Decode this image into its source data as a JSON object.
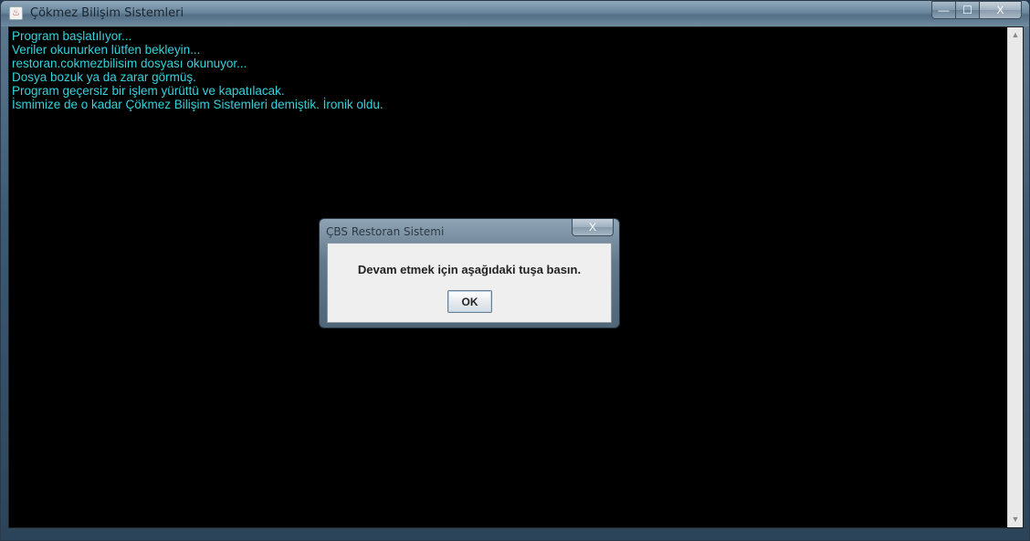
{
  "window": {
    "title": "Çökmez Bilişim Sistemleri",
    "minimize_glyph": "—",
    "maximize_glyph": "☐",
    "close_glyph": "X",
    "app_icon": "java-icon"
  },
  "console": {
    "lines": [
      "Program başlatılıyor...",
      "Veriler okunurken lütfen bekleyin...",
      "restoran.cokmezbilisim dosyası okunuyor...",
      "Dosya bozuk ya da zarar görmüş.",
      "Program geçersiz bir işlem yürüttü ve kapatılacak.",
      "İsmimize de o kadar Çökmez Bilişim Sistemleri demiştik. İronik oldu."
    ],
    "text_color": "#33d3dc",
    "background": "#000000"
  },
  "dialog": {
    "title": "ÇBS Restoran Sistemi",
    "close_glyph": "X",
    "message": "Devam etmek için aşağıdaki tuşa basın.",
    "ok_label": "OK"
  },
  "scrollbar": {
    "up_glyph": "▲",
    "down_glyph": "▼"
  }
}
